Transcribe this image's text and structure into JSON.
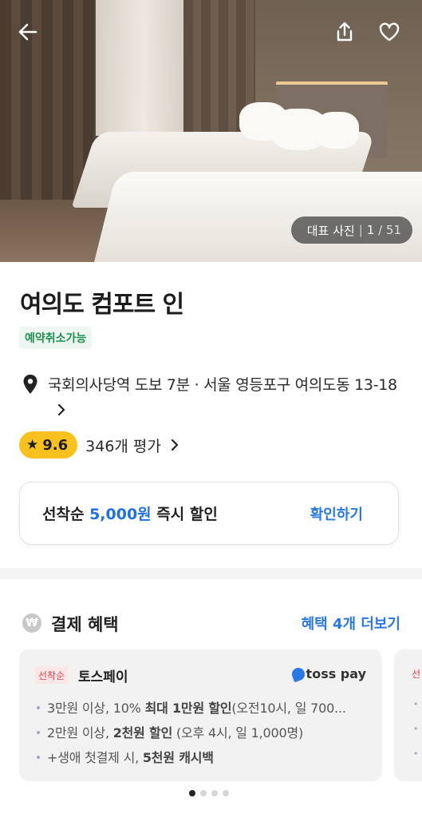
{
  "hero": {
    "photo_label": "대표 사진",
    "photo_index": "1",
    "photo_total": "51"
  },
  "hotel": {
    "name": "여의도 컴포트 인",
    "cancel_tag": "예약취소가능",
    "location": "국회의사당역 도보 7분 · 서울 영등포구 여의도동 13-18",
    "rating": "9.6",
    "review_count": "346개 평가"
  },
  "coupon": {
    "prefix": "선착순 ",
    "amount": "5,000원",
    "suffix": " 즉시 할인",
    "confirm_label": "확인하기"
  },
  "benefits": {
    "icon_text": "₩",
    "title": "결제 혜택",
    "more_label": "혜택 4개 더보기",
    "cards": [
      {
        "tag": "선착순",
        "title": "토스페이",
        "logo_text": "toss pay",
        "items": [
          {
            "pre": "3만원 이상, 10% ",
            "bold": "최대 1만원 할인",
            "post": "(오전10시, 일 700..."
          },
          {
            "pre": "2만원 이상, ",
            "bold": "2천원 할인",
            "post": " (오후 4시, 일 1,000명)"
          },
          {
            "pre": "+생애 첫결제 시, ",
            "bold": "5천원 캐시백",
            "post": ""
          }
        ]
      },
      {
        "tag": "선"
      }
    ],
    "page_count": 4,
    "active_page": 1
  },
  "colors": {
    "accent_blue": "#2a78e4",
    "green_tag": "#1e8f50",
    "rating_badge": "#f8c11d",
    "red_tag": "#e4424d"
  },
  "icons": [
    "back-arrow-icon",
    "share-icon",
    "heart-icon",
    "location-pin-icon",
    "star-icon",
    "chevron-right-icon",
    "won-icon",
    "toss-logo-icon"
  ]
}
